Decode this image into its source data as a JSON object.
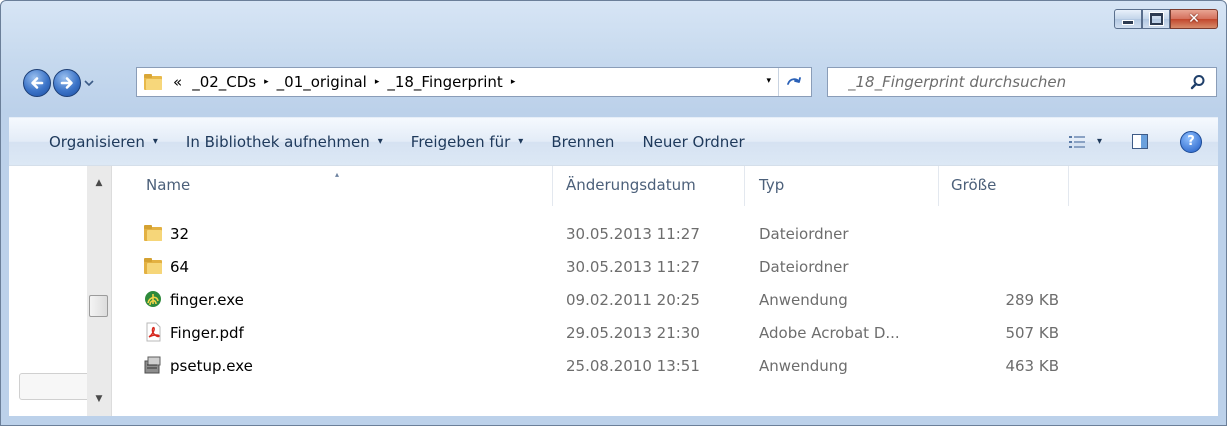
{
  "window": {
    "min_icon": "minimize-icon",
    "max_icon": "maximize-icon",
    "close_icon": "close-icon",
    "close_glyph": "✕"
  },
  "address": {
    "overflow": "«",
    "crumbs": [
      "_02_CDs",
      "_01_original",
      "_18_Fingerprint"
    ],
    "separator": "▸",
    "dropdown": "▾",
    "refresh": "⇆"
  },
  "search": {
    "placeholder": "_18_Fingerprint durchsuchen"
  },
  "toolbar": {
    "organize": "Organisieren",
    "library": "In Bibliothek aufnehmen",
    "share": "Freigeben für",
    "burn": "Brennen",
    "new_folder": "Neuer Ordner",
    "caret": "▾",
    "help": "?"
  },
  "columns": {
    "name": "Name",
    "date": "Änderungsdatum",
    "type": "Typ",
    "size": "Größe",
    "sort_indicator": "▴"
  },
  "files": [
    {
      "name": "32",
      "date": "30.05.2013 11:27",
      "type": "Dateiordner",
      "size": "",
      "icon": "folder-icon"
    },
    {
      "name": "64",
      "date": "30.05.2013 11:27",
      "type": "Dateiordner",
      "size": "",
      "icon": "folder-icon"
    },
    {
      "name": "finger.exe",
      "date": "09.02.2011 20:25",
      "type": "Anwendung",
      "size": "289 KB",
      "icon": "fingerprint-app-icon"
    },
    {
      "name": "Finger.pdf",
      "date": "29.05.2013 21:30",
      "type": "Adobe Acrobat D...",
      "size": "507 KB",
      "icon": "pdf-icon"
    },
    {
      "name": "psetup.exe",
      "date": "25.08.2010 13:51",
      "type": "Anwendung",
      "size": "463 KB",
      "icon": "setup-icon"
    }
  ],
  "scroll": {
    "up": "▲",
    "down": "▼"
  }
}
